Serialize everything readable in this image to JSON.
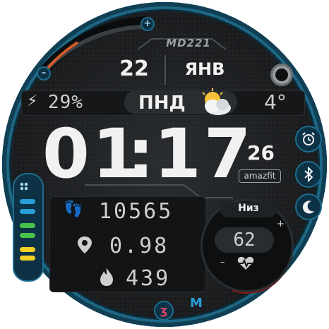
{
  "brand": "MD221",
  "date": {
    "day": "22",
    "month": "ЯНВ"
  },
  "battery": {
    "percent": "29%"
  },
  "weekday": "ПНД",
  "weather": {
    "temp": "4°",
    "icon": "partly-cloudy-icon"
  },
  "time": {
    "hours": "01",
    "sep": ":",
    "minutes": "17",
    "seconds": "26"
  },
  "logo": "amazfit",
  "stats": {
    "steps": "10565",
    "distance": "0.98",
    "calories": "439"
  },
  "heart": {
    "label": "Низ",
    "value": "62",
    "plus": "+",
    "minus": "–"
  },
  "left_buttons": {
    "plus": "+",
    "minus": "–"
  },
  "colors": {
    "accent": "#1c6a88",
    "bar_blue": "#2a9ed6",
    "bar_green": "#49c24c",
    "bar_yellow": "#f3d024"
  }
}
